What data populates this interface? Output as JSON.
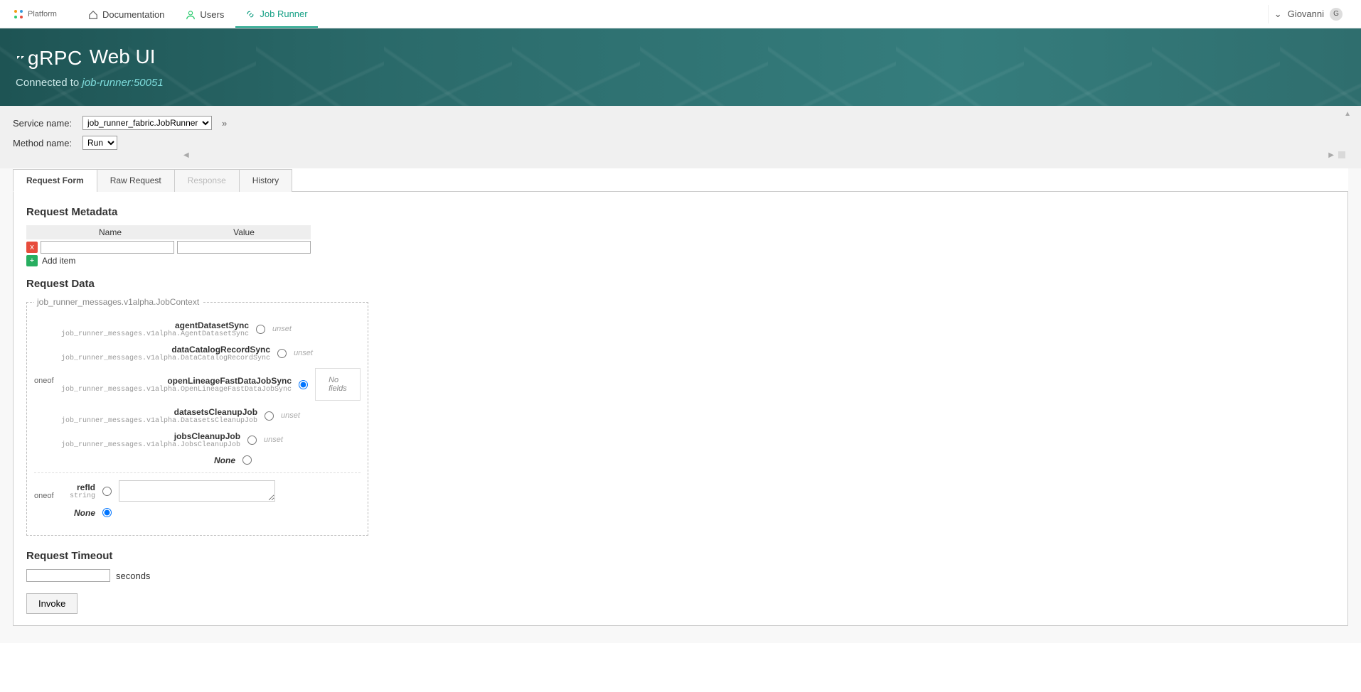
{
  "topbar": {
    "brand": "Platform",
    "nav": [
      {
        "label": "Documentation",
        "icon": "home-icon"
      },
      {
        "label": "Users",
        "icon": "user-icon"
      },
      {
        "label": "Job Runner",
        "icon": "link-icon",
        "active": true
      }
    ],
    "user": "Giovanni",
    "user_initial": "G"
  },
  "banner": {
    "product": "gRPC",
    "title": "Web UI",
    "connected_label": "Connected to",
    "address": "job-runner:50051"
  },
  "controls": {
    "service_label": "Service name:",
    "service_value": "job_runner_fabric.JobRunner",
    "method_label": "Method name:",
    "method_value": "Run"
  },
  "tabs": {
    "request_form": "Request Form",
    "raw_request": "Raw Request",
    "response": "Response",
    "history": "History"
  },
  "sections": {
    "metadata_title": "Request Metadata",
    "metadata_cols": {
      "name": "Name",
      "value": "Value"
    },
    "add_item": "Add item",
    "data_title": "Request Data",
    "timeout_title": "Request Timeout",
    "timeout_unit": "seconds",
    "invoke": "Invoke"
  },
  "request_data": {
    "legend": "job_runner_messages.v1alpha.JobContext",
    "oneof1_label": "oneof",
    "oneof1": [
      {
        "name": "agentDatasetSync",
        "type": "job_runner_messages.v1alpha.AgentDatasetSync",
        "value": "unset"
      },
      {
        "name": "dataCatalogRecordSync",
        "type": "job_runner_messages.v1alpha.DataCatalogRecordSync",
        "value": "unset"
      },
      {
        "name": "openLineageFastDataJobSync",
        "type": "job_runner_messages.v1alpha.OpenLineageFastDataJobSync",
        "value": "No fields",
        "selected": true
      },
      {
        "name": "datasetsCleanupJob",
        "type": "job_runner_messages.v1alpha.DatasetsCleanupJob",
        "value": "unset"
      },
      {
        "name": "jobsCleanupJob",
        "type": "job_runner_messages.v1alpha.JobsCleanupJob",
        "value": "unset"
      }
    ],
    "none_label": "None",
    "oneof2_label": "oneof",
    "oneof2_field_name": "refId",
    "oneof2_field_type": "string"
  }
}
